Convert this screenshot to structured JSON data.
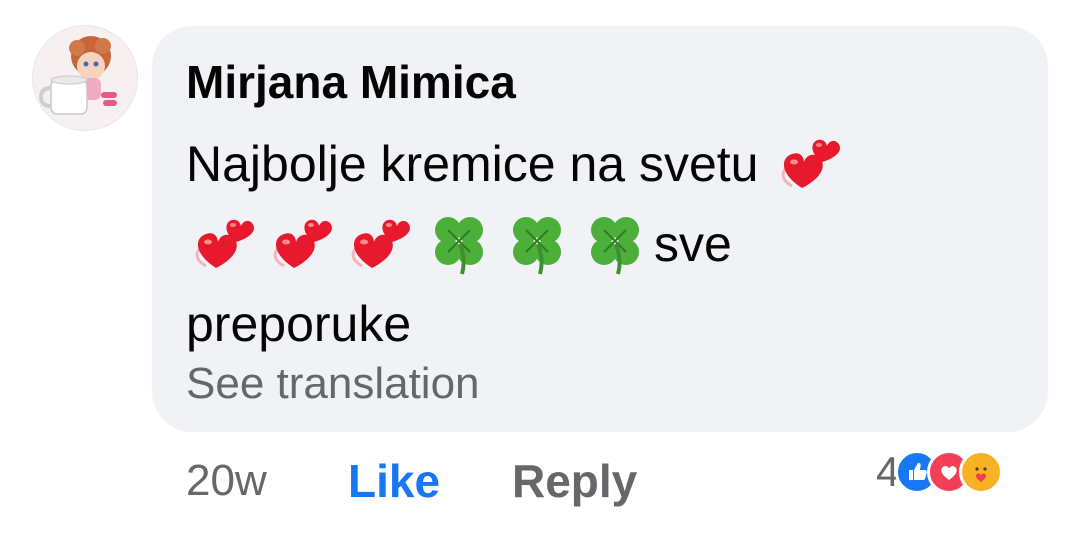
{
  "comment": {
    "author": "Mirjana Mimica",
    "message_line1": "Najbolje kremice na svetu ",
    "message_line2_text": "sve",
    "message_line3": "preporuke",
    "emojis_line1": [
      "revolving-hearts-icon"
    ],
    "emojis_line2": [
      "revolving-hearts-icon",
      "revolving-hearts-icon",
      "revolving-hearts-icon",
      "four-leaf-clover-icon",
      "four-leaf-clover-icon",
      "four-leaf-clover-icon"
    ],
    "see_translation": "See translation"
  },
  "actions": {
    "time": "20w",
    "like": "Like",
    "reply": "Reply"
  },
  "reactions": {
    "count": "4",
    "icons": [
      "like-icon",
      "love-icon",
      "care-icon"
    ]
  },
  "colors": {
    "bubble": "#f0f2f5",
    "like_blue": "#1877f2",
    "secondary_text": "#65676b",
    "heart_red": "#e8192c",
    "clover_green": "#4caf3a"
  }
}
